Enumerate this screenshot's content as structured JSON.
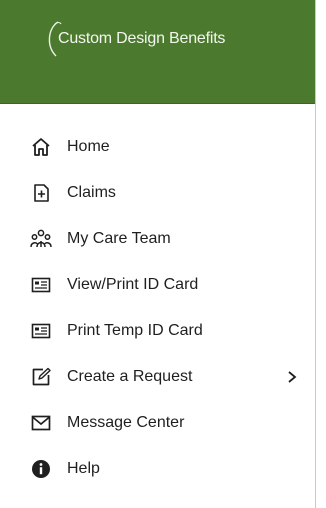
{
  "brand": {
    "name": "Custom Design Benefits",
    "header_color": "#4b7a2e"
  },
  "menu": {
    "items": [
      {
        "label": "Home",
        "icon": "home-icon"
      },
      {
        "label": "Claims",
        "icon": "claims-icon"
      },
      {
        "label": "My Care Team",
        "icon": "care-team-icon"
      },
      {
        "label": "View/Print ID Card",
        "icon": "id-card-icon"
      },
      {
        "label": "Print Temp ID Card",
        "icon": "id-card-icon"
      },
      {
        "label": "Create a Request",
        "icon": "edit-icon",
        "has_submenu": true
      },
      {
        "label": "Message Center",
        "icon": "envelope-icon"
      },
      {
        "label": "Help",
        "icon": "info-icon"
      }
    ]
  }
}
